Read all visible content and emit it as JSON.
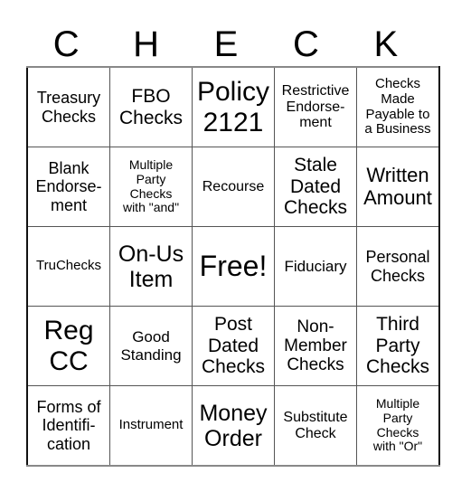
{
  "header": {
    "letters": [
      "C",
      "H",
      "E",
      "C",
      "K"
    ]
  },
  "grid": [
    [
      "Treasury\nChecks",
      "FBO\nChecks",
      "Policy\n2121",
      "Restrictive\nEndorse-\nment",
      "Checks\nMade\nPayable to\na Business"
    ],
    [
      "Blank\nEndorse-\nment",
      "Multiple\nParty\nChecks\nwith \"and\"",
      "Recourse",
      "Stale\nDated\nChecks",
      "Written\nAmount"
    ],
    [
      "TruChecks",
      "On-Us\nItem",
      "Free!",
      "Fiduciary",
      "Personal\nChecks"
    ],
    [
      "Reg\nCC",
      "Good\nStanding",
      "Post\nDated\nChecks",
      "Non-\nMember\nChecks",
      "Third\nParty\nChecks"
    ],
    [
      "Forms of\nIdentifi-\ncation",
      "Instrument",
      "Money\nOrder",
      "Substitute\nCheck",
      "Multiple\nParty\nChecks\nwith \"Or\""
    ]
  ]
}
